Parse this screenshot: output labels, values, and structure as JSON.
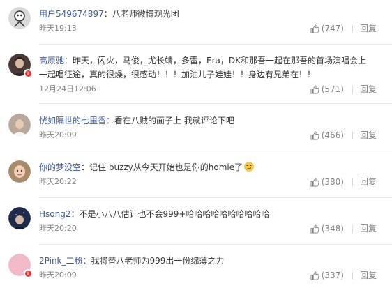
{
  "separator": "：",
  "comments": [
    {
      "user": "用户549674897",
      "text": "八老师微博观光团",
      "time": "昨天19:13",
      "likes": "(747)",
      "reply": "回复",
      "avatar_bg": "#d9d9d9"
    },
    {
      "user": "高原驰",
      "text": "昨天，闪火，马俊，尤长靖，多雷，Era，DK和那吾一起在那吾的首场演唱会上一起唱征途，真的很燥，很感动！！！加油儿子娃娃！！身边有兄弟在！！",
      "time": "12月24日12:06",
      "likes": "(571)",
      "reply": "回复",
      "avatar_bg": "#4a3a35"
    },
    {
      "user": "恍如隔世的七里香",
      "text": "看在八贼的面子上 我就评论下吧",
      "time": "昨天20:09",
      "likes": "(466)",
      "reply": "回复",
      "avatar_bg": "#b7a89a"
    },
    {
      "user": "你的梦没空",
      "text": "记住 buzzy从今天开始也是你的homie了",
      "time": "昨天20:22",
      "likes": "(380)",
      "reply": "回复",
      "avatar_bg": "#a88b6a"
    },
    {
      "user": "Hsong2",
      "text": "不是小八八估计也不会999+哈哈哈哈哈哈哈哈哈哈",
      "time": "昨天20:20",
      "likes": "(348)",
      "reply": "回复",
      "avatar_bg": "#1f2b4a"
    },
    {
      "user": "2Pink_二粉",
      "text": "我将替八老师为999出一份绵薄之力",
      "time": "昨天20:09",
      "likes": "(337)",
      "reply": "回复",
      "avatar_bg": "#f2b9c9"
    }
  ],
  "colors": {
    "name_orange": "#eb7350",
    "name_blue": "#3b5998",
    "badge_red": "#e8312f"
  },
  "icons": {
    "like": "thumb-up-icon",
    "verified": "verified-badge-icon",
    "emoji": "smirk-emoji"
  }
}
